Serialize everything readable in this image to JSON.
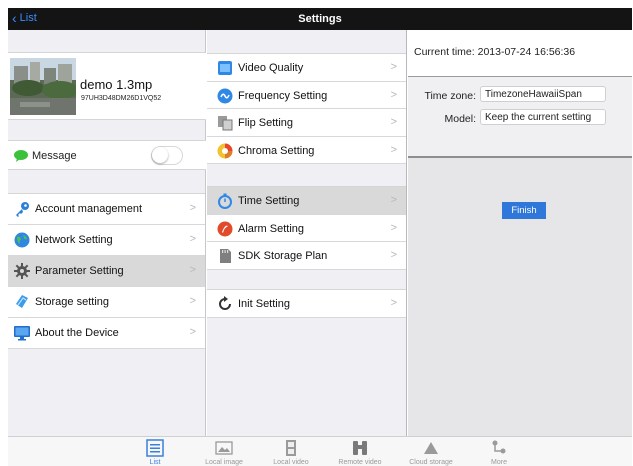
{
  "nav": {
    "back_label": "List",
    "title": "Settings"
  },
  "device": {
    "name": "demo 1.3mp",
    "uid": "97UH3D48DM26D1VQ52"
  },
  "message": {
    "label": "Message",
    "enabled": false
  },
  "left_menu": [
    {
      "label": "Account management",
      "icon": "key-icon"
    },
    {
      "label": "Network Setting",
      "icon": "globe-icon"
    },
    {
      "label": "Parameter Setting",
      "icon": "gear-icon",
      "selected": true
    },
    {
      "label": "Storage setting",
      "icon": "storage-icon"
    },
    {
      "label": "About the Device",
      "icon": "monitor-icon"
    }
  ],
  "param_group_1": [
    {
      "label": "Video Quality",
      "icon": "video-quality-icon"
    },
    {
      "label": "Frequency Setting",
      "icon": "frequency-icon"
    },
    {
      "label": "Flip Setting",
      "icon": "flip-icon"
    },
    {
      "label": "Chroma Setting",
      "icon": "chroma-icon"
    }
  ],
  "param_group_2": [
    {
      "label": "Time Setting",
      "icon": "stopwatch-icon",
      "selected": true
    },
    {
      "label": "Alarm Setting",
      "icon": "alarm-icon"
    },
    {
      "label": "SDK Storage Plan",
      "icon": "sd-card-icon"
    }
  ],
  "param_group_3": [
    {
      "label": "Init Setting",
      "icon": "refresh-icon"
    }
  ],
  "time_setting": {
    "current_time_label": "Current time: 2013-07-24 16:56:36",
    "timezone_label": "Time zone:",
    "timezone_value": "TimezoneHawaiiSpan",
    "model_label": "Model:",
    "model_value": "Keep the current setting",
    "finish_label": "Finish"
  },
  "tabs": [
    {
      "label": "List",
      "icon": "list-icon",
      "active": true
    },
    {
      "label": "Local image",
      "icon": "image-icon"
    },
    {
      "label": "Local video",
      "icon": "film-icon"
    },
    {
      "label": "Remote video",
      "icon": "binoculars-icon"
    },
    {
      "label": "Cloud storage",
      "icon": "cloud-icon"
    },
    {
      "label": "More",
      "icon": "more-icon"
    }
  ],
  "colors": {
    "accent": "#2f77d8",
    "link": "#3b8cff",
    "topbar": "#141414",
    "selected_row": "#d9d9d9"
  }
}
